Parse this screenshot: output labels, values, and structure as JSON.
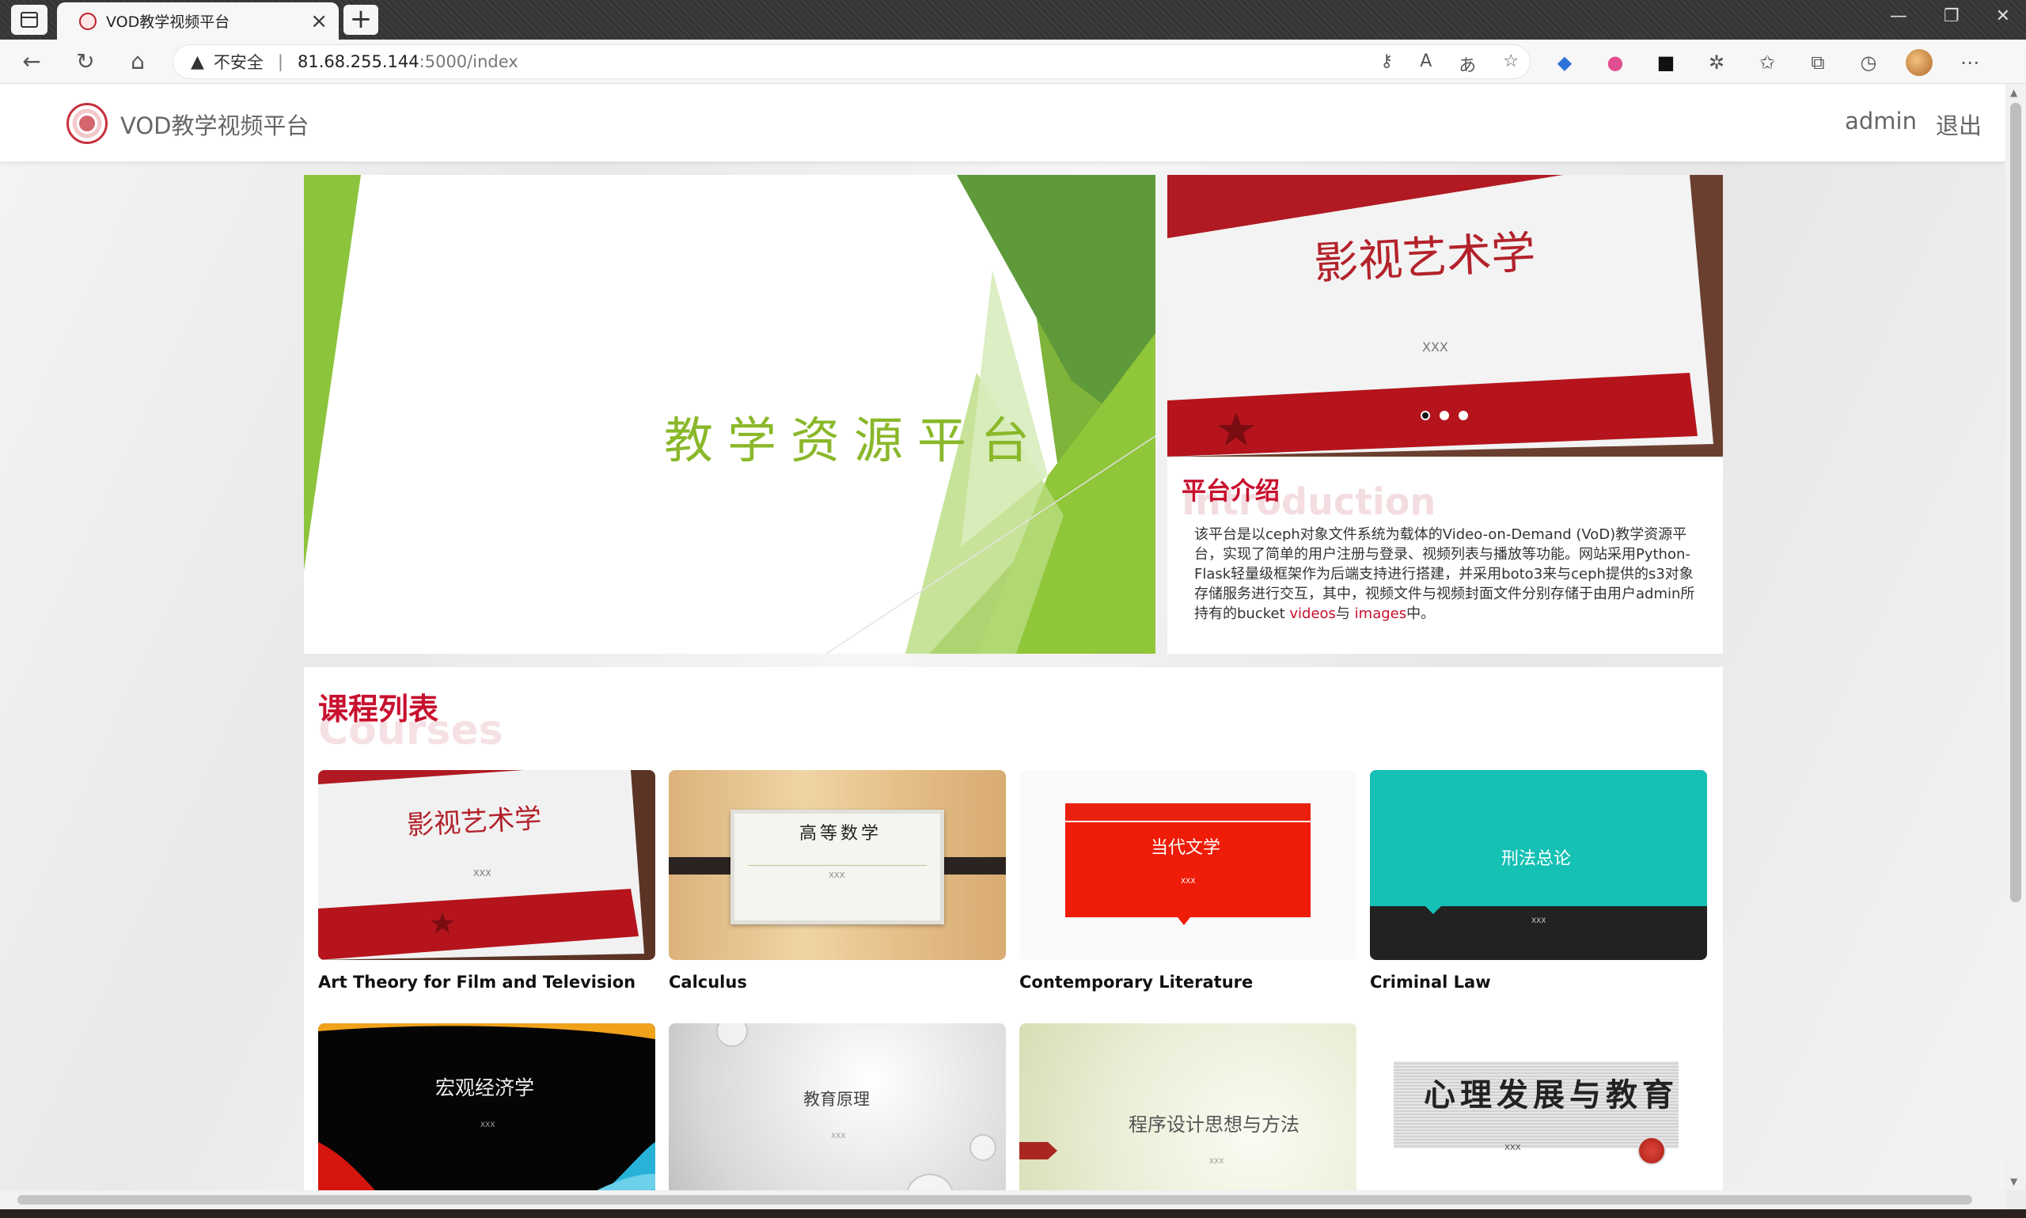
{
  "browser": {
    "tab_title": "VOD教学视频平台",
    "insecure_label": "不安全",
    "url_host": "81.68.255.144",
    "url_path": ":5000/index"
  },
  "site": {
    "brand": "VOD教学视频平台",
    "user": "admin",
    "logout": "退出"
  },
  "banner": {
    "title": "教学资源平台"
  },
  "intro_image": {
    "title": "影视艺术学",
    "subtitle": "XXX"
  },
  "intro": {
    "title": "平台介绍",
    "ghost": "Introduction",
    "text_before": "该平台是以ceph对象文件系统为载体的Video-on-Demand (VoD)教学资源平台，实现了简单的用户注册与登录、视频列表与播放等功能。网站采用Python-Flask轻量级框架作为后端支持进行搭建，并采用boto3来与ceph提供的s3对象存储服务进行交互，其中，视频文件与视频封面文件分别存储于由用户admin所持有的bucket ",
    "link_videos": "videos",
    "text_mid": "与 ",
    "link_images": "images",
    "text_after": "中。"
  },
  "courses": {
    "title": "课程列表",
    "ghost": "Courses",
    "items": [
      {
        "name": "Art Theory for Film and Television",
        "cover_text": "影视艺术学",
        "cover_sub": "XXX"
      },
      {
        "name": "Calculus",
        "cover_text": "高等数学",
        "cover_sub": "XXX"
      },
      {
        "name": "Contemporary Literature",
        "cover_text": "当代文学",
        "cover_sub": "XXX"
      },
      {
        "name": "Criminal Law",
        "cover_text": "刑法总论",
        "cover_sub": "XXX"
      },
      {
        "name": "",
        "cover_text": "宏观经济学",
        "cover_sub": "XXX"
      },
      {
        "name": "",
        "cover_text": "教育原理",
        "cover_sub": "XXX"
      },
      {
        "name": "",
        "cover_text": "程序设计思想与方法",
        "cover_sub": "XXX"
      },
      {
        "name": "",
        "cover_text": "心理发展与教育",
        "cover_sub": "XXX"
      }
    ]
  }
}
